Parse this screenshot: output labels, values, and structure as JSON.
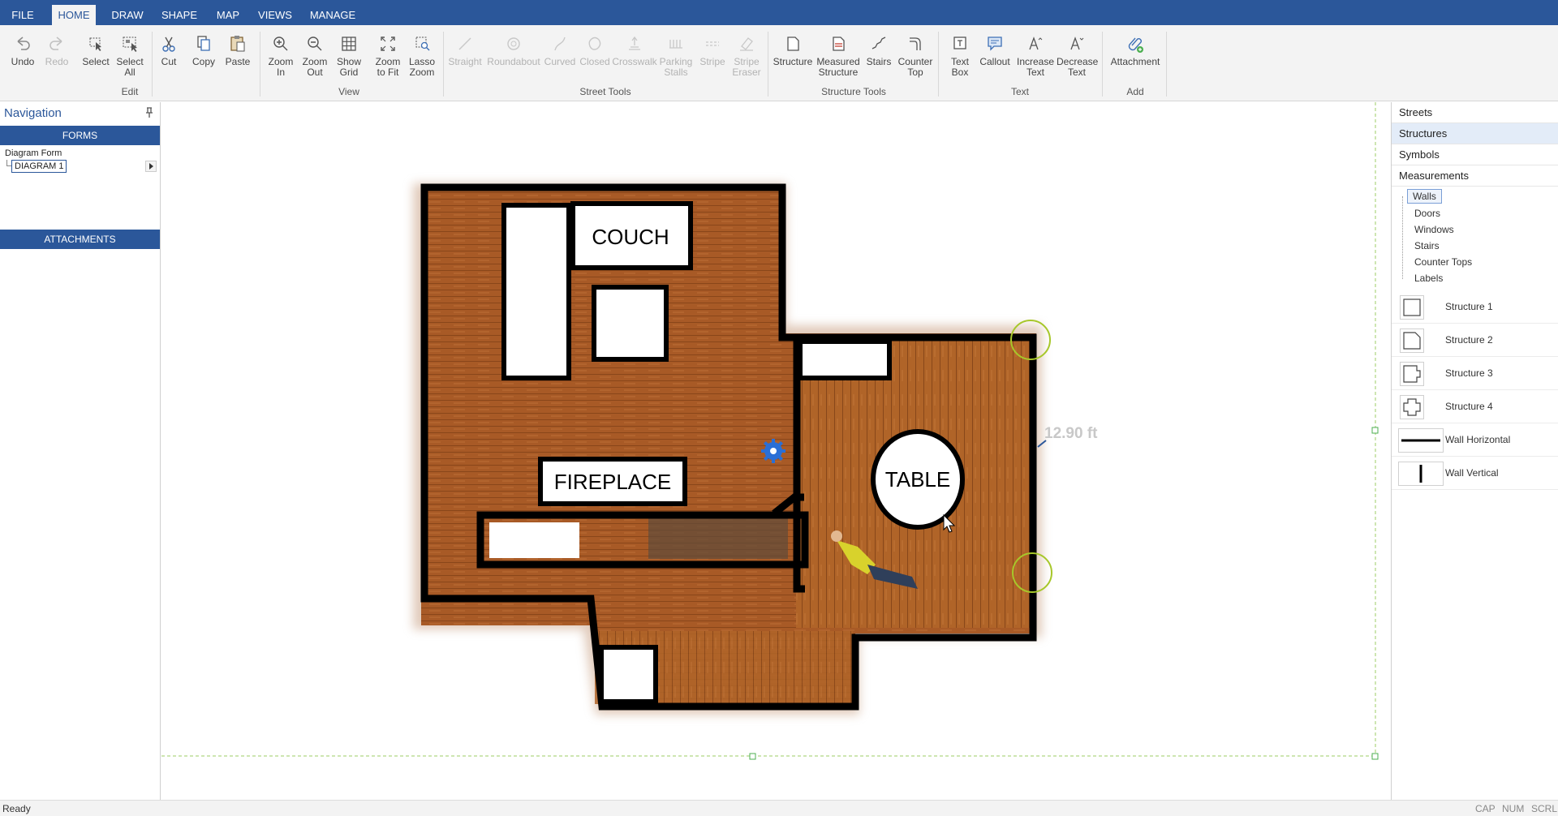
{
  "menu": {
    "tabs": [
      "FILE",
      "HOME",
      "DRAW",
      "SHAPE",
      "MAP",
      "VIEWS",
      "MANAGE"
    ],
    "active": "HOME"
  },
  "ribbon": {
    "undo": "Undo",
    "redo": "Redo",
    "select": "Select",
    "select_all_1": "Select",
    "select_all_2": "All",
    "edit_group": "Edit",
    "cut": "Cut",
    "copy": "Copy",
    "paste": "Paste",
    "zoom_in_1": "Zoom",
    "zoom_in_2": "In",
    "zoom_out_1": "Zoom",
    "zoom_out_2": "Out",
    "show_grid_1": "Show",
    "show_grid_2": "Grid",
    "zoom_fit_1": "Zoom",
    "zoom_fit_2": "to Fit",
    "lasso_1": "Lasso",
    "lasso_2": "Zoom",
    "view_group": "View",
    "straight": "Straight",
    "roundabout": "Roundabout",
    "curved": "Curved",
    "closed": "Closed",
    "crosswalk": "Crosswalk",
    "parking_1": "Parking",
    "parking_2": "Stalls",
    "stripe": "Stripe",
    "stripe_eraser_1": "Stripe",
    "stripe_eraser_2": "Eraser",
    "street_group": "Street Tools",
    "structure": "Structure",
    "measured_1": "Measured",
    "measured_2": "Structure",
    "stairs": "Stairs",
    "counter_1": "Counter",
    "counter_2": "Top",
    "structure_group": "Structure Tools",
    "textbox_1": "Text",
    "textbox_2": "Box",
    "callout": "Callout",
    "inc_text_1": "Increase",
    "inc_text_2": "Text",
    "dec_text_1": "Decrease",
    "dec_text_2": "Text",
    "text_group": "Text",
    "attachment": "Attachment",
    "add_group": "Add"
  },
  "navigation": {
    "title": "Navigation",
    "forms_band": "FORMS",
    "form_label": "Diagram Form",
    "form_item": "DIAGRAM 1",
    "attachments_band": "ATTACHMENTS"
  },
  "diagram": {
    "couch": "COUCH",
    "fireplace": "FIREPLACE",
    "table": "TABLE",
    "measurement": "12.90 ft"
  },
  "right_panel": {
    "headers": [
      "Streets",
      "Structures",
      "Symbols",
      "Measurements"
    ],
    "selected_header": "Structures",
    "measurement_items": [
      "Walls",
      "Doors",
      "Windows",
      "Stairs",
      "Counter Tops",
      "Labels"
    ],
    "selected_measurement": "Walls",
    "structures": [
      "Structure 1",
      "Structure 2",
      "Structure 3",
      "Structure 4",
      "Wall Horizontal",
      "Wall Vertical"
    ]
  },
  "status": {
    "text": "Ready",
    "indicators": [
      "CAP",
      "NUM",
      "SCRL"
    ]
  },
  "colors": {
    "accent": "#2b579a",
    "floor": "#a85a26",
    "wall": "#000000",
    "handle": "#a7c72a",
    "gear": "#2a6fd6"
  }
}
